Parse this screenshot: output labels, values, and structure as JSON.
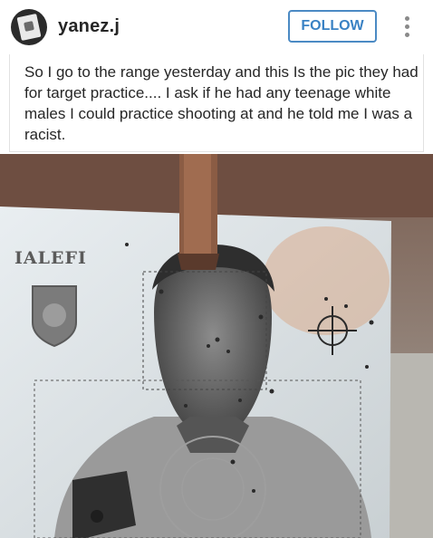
{
  "post": {
    "username": "yanez.j",
    "follow_label": "FOLLOW",
    "more_icon": "more-vertical-icon",
    "caption": "So I go to the range yesterday and this Is the pic they had for target practice.... I ask if he had any teenage white males I could practice shooting at and he told me I was a racist."
  },
  "photo": {
    "target_brand": "IALEFI"
  },
  "colors": {
    "follow_blue": "#3a82c4",
    "text": "#262626"
  }
}
